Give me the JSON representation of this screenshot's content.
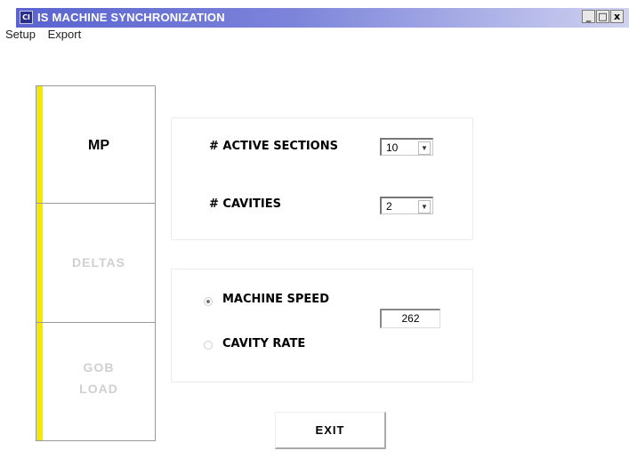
{
  "window": {
    "title": "IS MACHINE SYNCHRONIZATION",
    "icon_text": "CI",
    "minimize": "_",
    "maximize": "□",
    "close": "x"
  },
  "menu": [
    "Setup",
    "Export"
  ],
  "tabs": [
    {
      "label": "MP",
      "active": true
    },
    {
      "label": "DELTAS",
      "active": false
    },
    {
      "label_lines": [
        "GOB",
        "LOAD"
      ],
      "active": false
    }
  ],
  "config": {
    "active_sections": {
      "label": "# ACTIVE SECTIONS",
      "value": "10"
    },
    "cavities": {
      "label": "# CAVITIES",
      "value": "2"
    }
  },
  "rate": {
    "machine_speed": {
      "label": "MACHINE SPEED",
      "selected": true
    },
    "cavity_rate": {
      "label": "CAVITY RATE",
      "selected": false
    },
    "value": "262"
  },
  "exit_label": "EXIT",
  "colors": {
    "tab_accent": "#f3e800",
    "title_bar": "#5a63cf"
  }
}
